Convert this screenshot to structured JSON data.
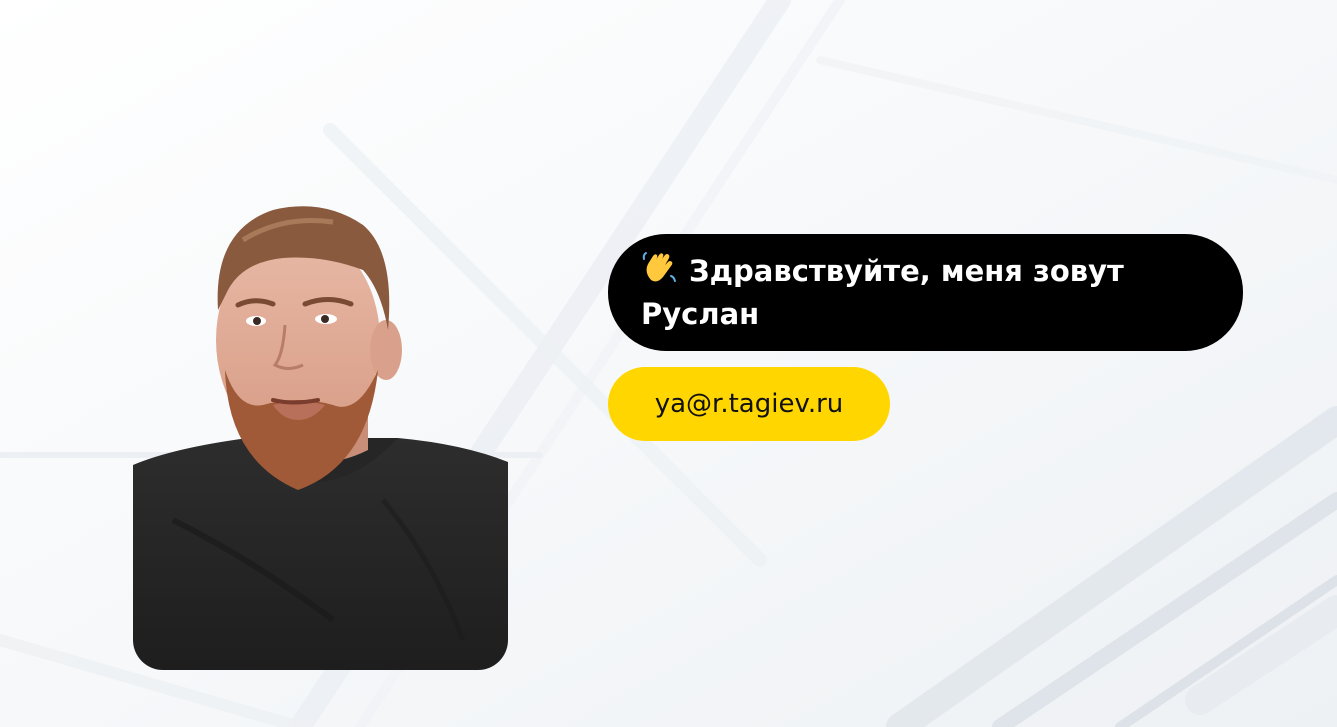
{
  "greeting": {
    "icon": "waving-hand-icon",
    "text": "Здравствуйте, меня зовут Руслан"
  },
  "contact": {
    "email": "ya@r.tagiev.ru"
  },
  "photo": {
    "icon": "profile-photo"
  },
  "colors": {
    "background": "#f8f9fb",
    "greeting_bg": "#000000",
    "greeting_text": "#ffffff",
    "email_bg": "#ffd600",
    "email_text": "#111111"
  }
}
